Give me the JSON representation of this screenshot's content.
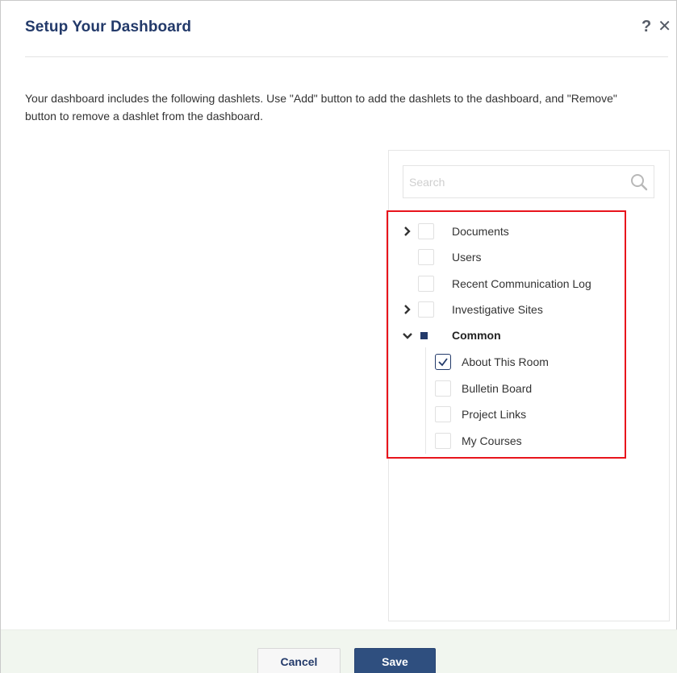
{
  "dialog": {
    "title": "Setup Your Dashboard",
    "help_glyph": "?",
    "close_glyph": "✕",
    "intro": "Your dashboard includes the following dashlets. Use \"Add\" button to add the dashlets to the dashboard, and \"Remove\" button to remove a dashlet from the dashboard."
  },
  "search": {
    "placeholder": "Search",
    "value": "",
    "icon": "search-icon"
  },
  "tree": {
    "items": [
      {
        "label": "Documents",
        "state": "unchecked",
        "expander": "collapsed"
      },
      {
        "label": "Users",
        "state": "unchecked",
        "expander": "none"
      },
      {
        "label": "Recent Communication Log",
        "state": "unchecked",
        "expander": "none"
      },
      {
        "label": "Investigative Sites",
        "state": "unchecked",
        "expander": "collapsed"
      },
      {
        "label": "Common",
        "state": "partial",
        "expander": "expanded",
        "children": [
          {
            "label": "About This Room",
            "state": "checked"
          },
          {
            "label": "Bulletin Board",
            "state": "unchecked"
          },
          {
            "label": "Project Links",
            "state": "unchecked"
          },
          {
            "label": "My Courses",
            "state": "unchecked"
          }
        ]
      }
    ]
  },
  "footer": {
    "cancel_label": "Cancel",
    "save_label": "Save"
  },
  "colors": {
    "brand_navy": "#233a6a",
    "save_button": "#2f4f7f",
    "highlight_red": "#e8141c",
    "footer_bg": "#f1f6ef"
  }
}
